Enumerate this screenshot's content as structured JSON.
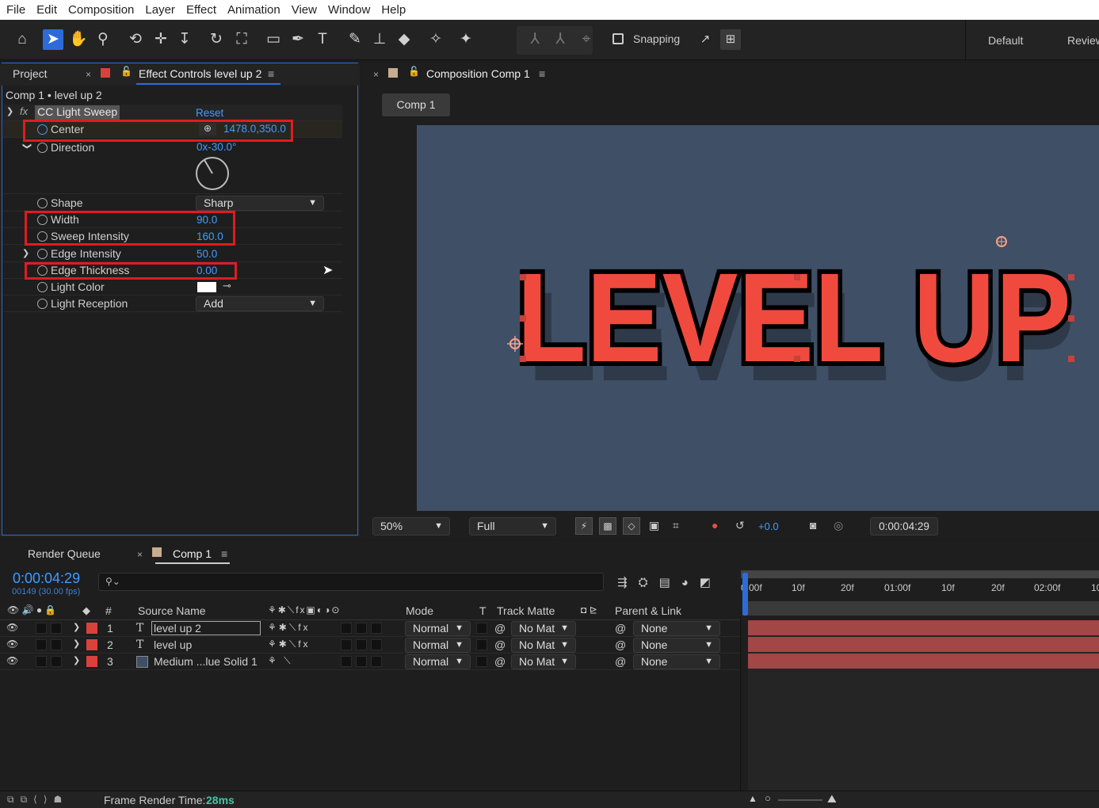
{
  "menu": [
    "File",
    "Edit",
    "Composition",
    "Layer",
    "Effect",
    "Animation",
    "View",
    "Window",
    "Help"
  ],
  "toolbar": {
    "snapping": "Snapping",
    "workspace1": "Default",
    "workspace2": "Review"
  },
  "left_panel": {
    "tab_project": "Project",
    "tab_effect": "Effect Controls level up 2",
    "breadcrumb": "Comp 1 • level up 2",
    "effect_name": "CC Light Sweep",
    "reset": "Reset",
    "props": {
      "center": {
        "label": "Center",
        "value": "1478.0,350.0"
      },
      "direction": {
        "label": "Direction",
        "value": "0x-30.0°"
      },
      "shape": {
        "label": "Shape",
        "value": "Sharp"
      },
      "width": {
        "label": "Width",
        "value": "90.0"
      },
      "sweep": {
        "label": "Sweep Intensity",
        "value": "160.0"
      },
      "edge_int": {
        "label": "Edge Intensity",
        "value": "50.0"
      },
      "edge_thick": {
        "label": "Edge Thickness",
        "value": "0.00"
      },
      "light_color": {
        "label": "Light Color",
        "value": "#ffffff"
      },
      "light_rec": {
        "label": "Light Reception",
        "value": "Add"
      }
    }
  },
  "comp_panel": {
    "tab": "Composition Comp 1",
    "chip": "Comp 1",
    "text": "LEVEL UP",
    "zoom": "50%",
    "quality": "Full",
    "exposure": "+0.0",
    "timecode": "0:00:04:29",
    "colors": {
      "bg": "#3f4f66",
      "text": "#f04a3e",
      "stroke": "#000000",
      "shadow": "#2e3a4a"
    }
  },
  "timeline": {
    "tab_rq": "Render Queue",
    "tab_comp": "Comp 1",
    "timecode": "0:00:04:29",
    "frames": "00149 (30.00 fps)",
    "headers": {
      "num": "#",
      "source": "Source Name",
      "mode": "Mode",
      "t": "T",
      "track": "Track Matte",
      "parent": "Parent & Link"
    },
    "ruler": [
      "0:00f",
      "10f",
      "20f",
      "01:00f",
      "10f",
      "20f",
      "02:00f",
      "10"
    ],
    "layers": [
      {
        "num": "1",
        "name": "level up 2",
        "mode": "Normal",
        "matte": "No Mat",
        "parent": "None"
      },
      {
        "num": "2",
        "name": "level up",
        "mode": "Normal",
        "matte": "No Mat",
        "parent": "None"
      },
      {
        "num": "3",
        "name": "Medium ...lue Solid 1",
        "mode": "Normal",
        "matte": "No Mat",
        "parent": "None"
      }
    ],
    "render_label": "Frame Render Time:",
    "render_value": "28ms"
  }
}
